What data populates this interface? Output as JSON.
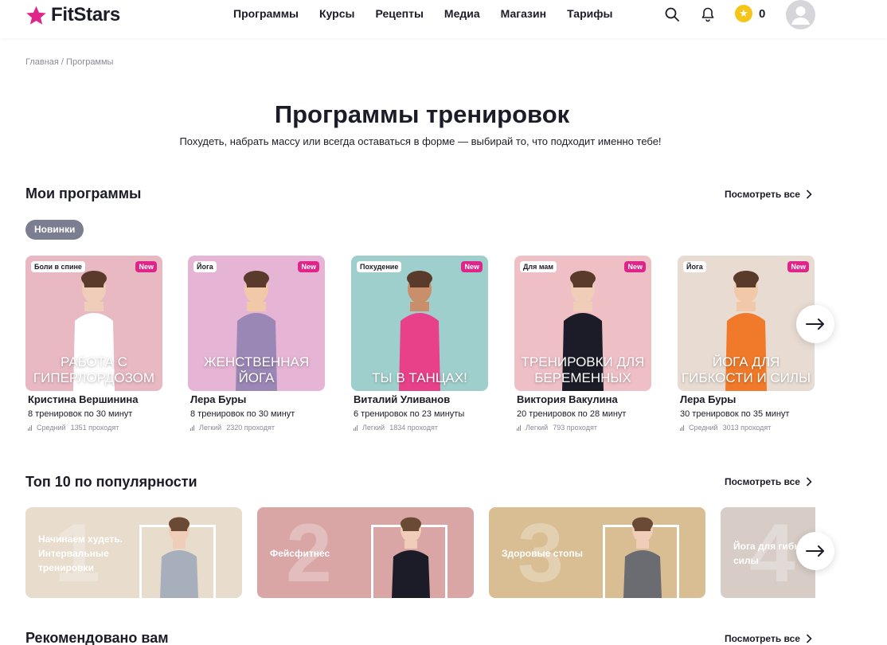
{
  "header": {
    "logo_text": "FitStars",
    "nav": [
      "Программы",
      "Курсы",
      "Рецепты",
      "Медиа",
      "Магазин",
      "Тарифы"
    ],
    "coins": "0",
    "brand_color": "#e0258a"
  },
  "breadcrumb": {
    "home": "Главная",
    "separator": " / ",
    "current": "Программы"
  },
  "page": {
    "title": "Программы тренировок",
    "subtitle": "Похудеть, набрать массу или всегда оставаться в форме — выбирай то, что подходит именно тебе!"
  },
  "my_programs": {
    "title": "Мои программы",
    "see_all": "Посмотреть все",
    "filter_chip": "Новинки",
    "cards": [
      {
        "tag": "Боли в спине",
        "badge": "New",
        "cover": "Работа с гиперлордозом",
        "author": "Кристина Вершинина",
        "meta": "8 тренировок по 30 минут",
        "level": "Средний",
        "passed": "1351 проходят",
        "bg": "#e8b9c3"
      },
      {
        "tag": "Йога",
        "badge": "New",
        "cover": "Женственная йога",
        "author": "Лера Буры",
        "meta": "8 тренировок по 30 минут",
        "level": "Легкий",
        "passed": "2320 проходят",
        "bg": "#e6b4d4"
      },
      {
        "tag": "Похудение",
        "badge": "New",
        "cover": "Ты в танцах!",
        "author": "Виталий Уливанов",
        "meta": "6 тренировок по 23 минуты",
        "level": "Легкий",
        "passed": "1834 проходят",
        "bg": "#9ecfcc"
      },
      {
        "tag": "Для мам",
        "badge": "New",
        "cover": "Тренировки для беременных",
        "author": "Виктория Вакулина",
        "meta": "20 тренировок по 28 минут",
        "level": "Легкий",
        "passed": "793 проходят",
        "bg": "#efbfc6"
      },
      {
        "tag": "Йога",
        "badge": "New",
        "cover": "Йога для гибкости и силы",
        "author": "Лера Буры",
        "meta": "30 тренировок по 35 минут",
        "level": "Средний",
        "passed": "3013 проходят",
        "bg": "#e8dcd2"
      }
    ]
  },
  "top10": {
    "title": "Топ 10 по популярности",
    "see_all": "Посмотреть все",
    "cards": [
      {
        "num": "1",
        "label": "Начинаем худеть. Интервальные тренировки",
        "bg": "#e8dccc"
      },
      {
        "num": "2",
        "label": "Фейсфитнес",
        "bg": "#d9a5a5"
      },
      {
        "num": "3",
        "label": "Здоровые стопы",
        "bg": "#d9be94"
      },
      {
        "num": "4",
        "label": "Йога для гибкости и силы",
        "bg": "#d7ccc6"
      }
    ]
  },
  "recommended": {
    "title": "Рекомендовано вам",
    "see_all": "Посмотреть все"
  }
}
